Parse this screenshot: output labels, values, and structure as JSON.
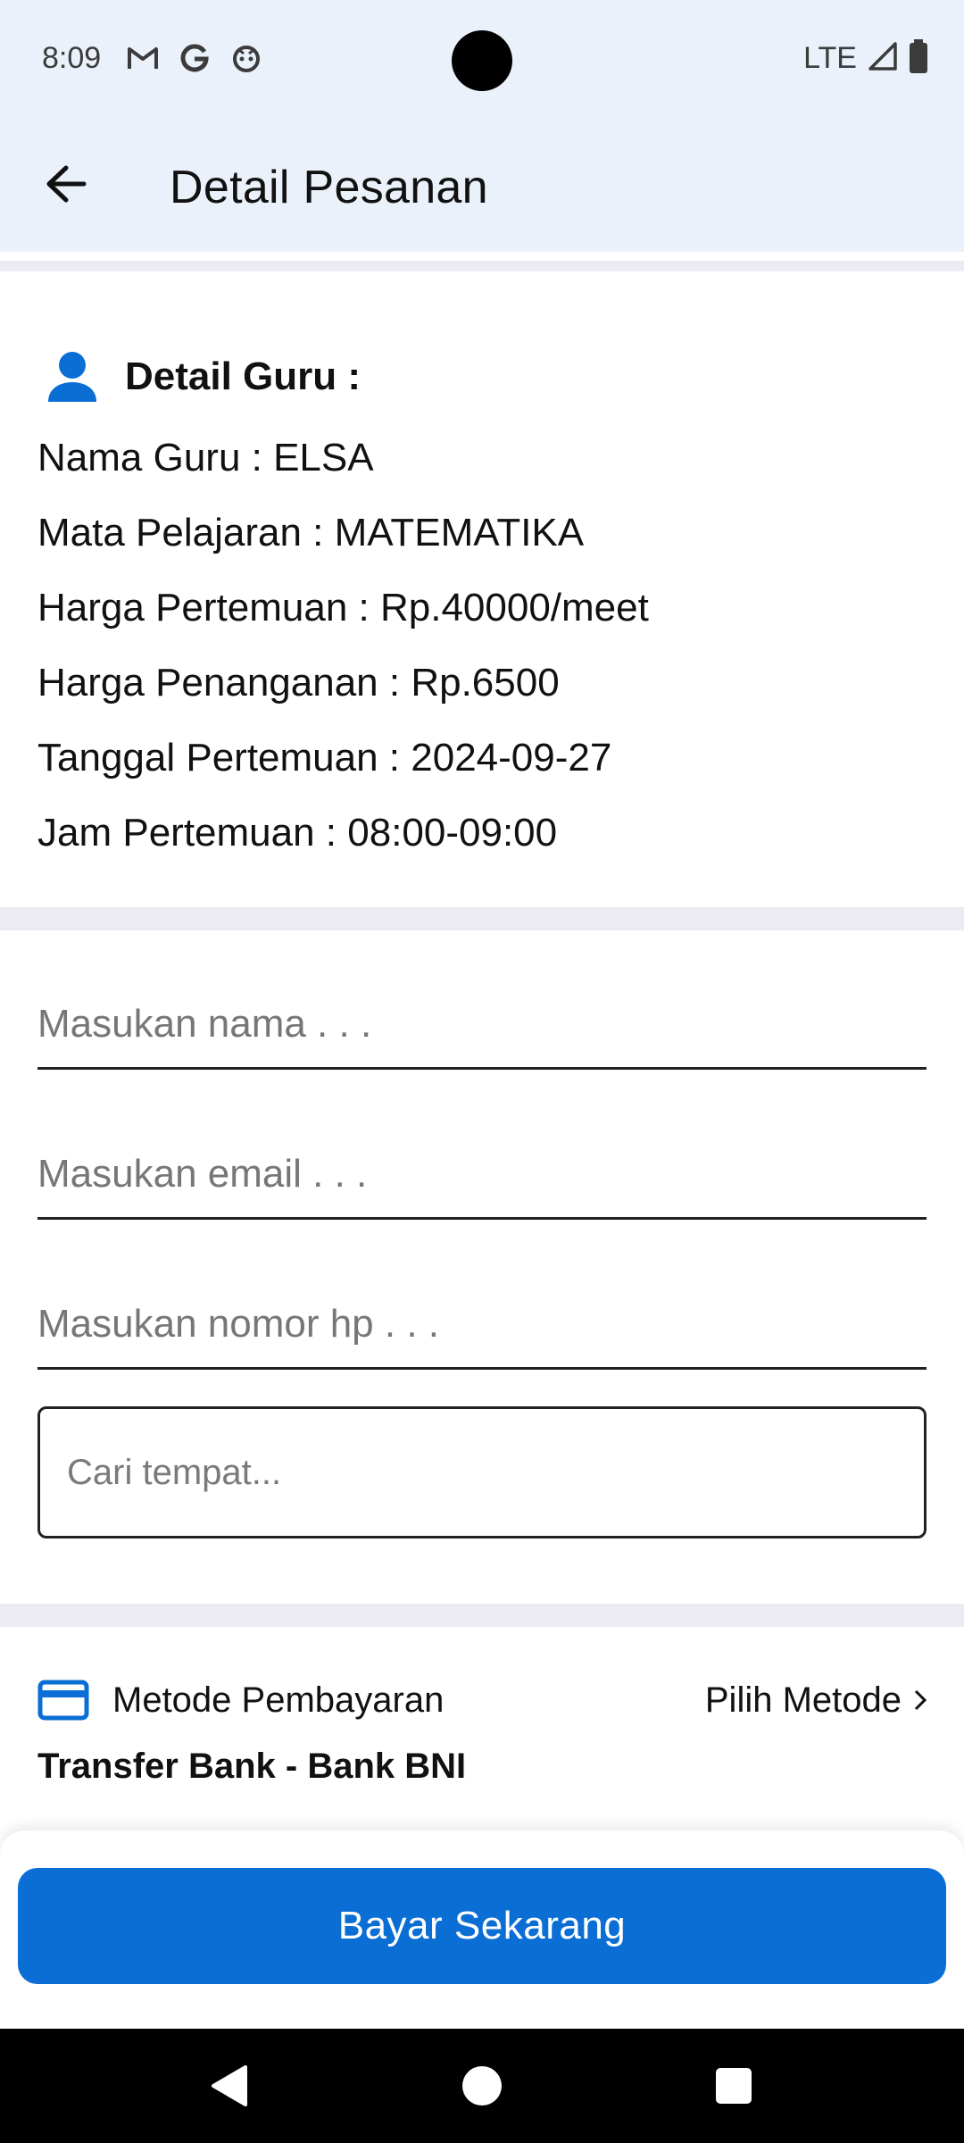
{
  "status_bar": {
    "time": "8:09",
    "network": "LTE",
    "icons": [
      "gmail-icon",
      "google-icon",
      "app-icon",
      "signal-icon",
      "battery-icon"
    ]
  },
  "app_bar": {
    "title": "Detail Pesanan"
  },
  "teacher": {
    "heading": "Detail Guru :",
    "lines": [
      "Nama Guru : ELSA",
      "Mata Pelajaran : MATEMATIKA",
      "Harga Pertemuan : Rp.40000/meet",
      "Harga Penanganan : Rp.6500",
      "Tanggal Pertemuan : 2024-09-27",
      "Jam Pertemuan : 08:00-09:00"
    ]
  },
  "form": {
    "name_placeholder": "Masukan nama . . .",
    "email_placeholder": "Masukan email . . .",
    "phone_placeholder": "Masukan nomor hp . . .",
    "place_placeholder": "Cari tempat..."
  },
  "payment": {
    "label": "Metode Pembayaran",
    "choose_label": "Pilih Metode",
    "selected": "Transfer Bank - Bank BNI"
  },
  "actions": {
    "pay_label": "Bayar Sekarang"
  },
  "colors": {
    "primary": "#0a6ed5",
    "appbar_bg": "#ebf1fb",
    "divider": "#ecebf4"
  }
}
